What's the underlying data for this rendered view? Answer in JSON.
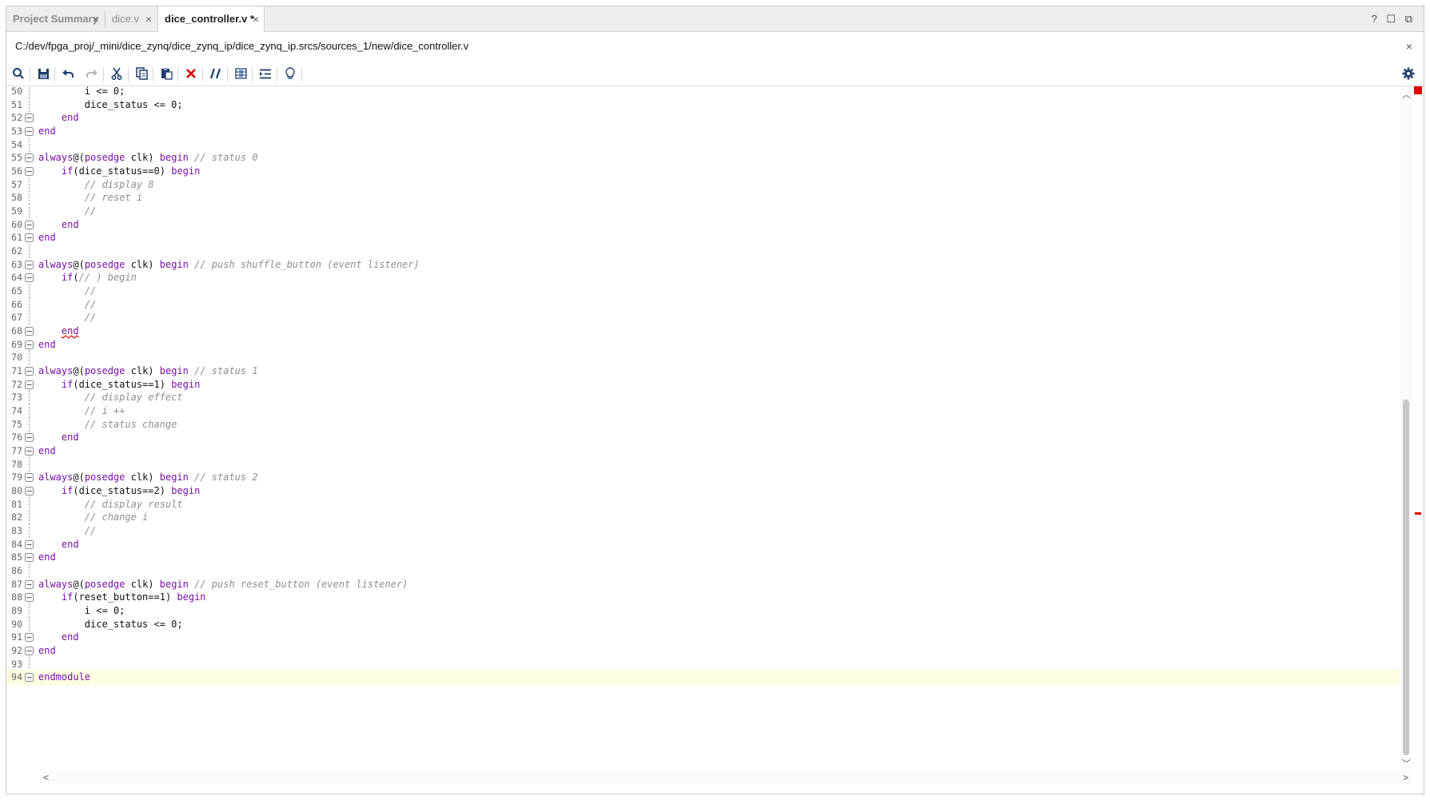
{
  "tabs": [
    {
      "label": "Project Summary",
      "active": false
    },
    {
      "label": "dice.v",
      "active": false
    },
    {
      "label": "dice_controller.v *",
      "active": true
    }
  ],
  "window_controls": {
    "help": "?",
    "restore": "☐",
    "detach": "⧉"
  },
  "path": "C:/dev/fpga_proj/_mini/dice_zynq/dice_zynq_ip/dice_zynq_ip.srcs/sources_1/new/dice_controller.v",
  "toolbar": {
    "buttons": [
      "search-icon",
      "save-icon",
      "undo-icon",
      "redo-icon",
      "cut-icon",
      "copy-icon",
      "paste-icon",
      "delete-icon",
      "comment-icon",
      "column-select-icon",
      "indent-icon",
      "lightbulb-icon"
    ],
    "settings": "gear-icon"
  },
  "colors": {
    "keyword": "#7a0fa6",
    "comment": "#8e8e8e",
    "error_marker": "#e00000",
    "current_line": "#fffde1"
  },
  "lines": [
    {
      "n": "50",
      "fold": false,
      "tokens": [
        [
          "",
          "        i <= 0;"
        ]
      ]
    },
    {
      "n": "51",
      "fold": false,
      "tokens": [
        [
          "",
          "        dice_status <= 0;"
        ]
      ]
    },
    {
      "n": "52",
      "fold": true,
      "tokens": [
        [
          "kw",
          "    end"
        ]
      ]
    },
    {
      "n": "53",
      "fold": true,
      "tokens": [
        [
          "kw",
          "end"
        ]
      ]
    },
    {
      "n": "54",
      "fold": false,
      "tokens": []
    },
    {
      "n": "55",
      "fold": true,
      "tokens": [
        [
          "kw",
          "always"
        ],
        [
          "",
          "@("
        ],
        [
          "kw",
          "posedge"
        ],
        [
          "",
          " clk) "
        ],
        [
          "kw",
          "begin"
        ],
        [
          "cm",
          " // status 0"
        ]
      ]
    },
    {
      "n": "56",
      "fold": true,
      "tokens": [
        [
          "",
          "    "
        ],
        [
          "kw",
          "if"
        ],
        [
          "",
          "(dice_status==0) "
        ],
        [
          "kw",
          "begin"
        ]
      ]
    },
    {
      "n": "57",
      "fold": false,
      "tokens": [
        [
          "cm",
          "        // display 8"
        ]
      ]
    },
    {
      "n": "58",
      "fold": false,
      "tokens": [
        [
          "cm",
          "        // reset i"
        ]
      ]
    },
    {
      "n": "59",
      "fold": false,
      "tokens": [
        [
          "cm",
          "        //"
        ]
      ]
    },
    {
      "n": "60",
      "fold": true,
      "tokens": [
        [
          "kw",
          "    end"
        ]
      ]
    },
    {
      "n": "61",
      "fold": true,
      "tokens": [
        [
          "kw",
          "end"
        ]
      ]
    },
    {
      "n": "62",
      "fold": false,
      "tokens": []
    },
    {
      "n": "63",
      "fold": true,
      "tokens": [
        [
          "kw",
          "always"
        ],
        [
          "",
          "@("
        ],
        [
          "kw",
          "posedge"
        ],
        [
          "",
          " clk) "
        ],
        [
          "kw",
          "begin"
        ],
        [
          "cm",
          " // push shuffle_button (event listener)"
        ]
      ]
    },
    {
      "n": "64",
      "fold": true,
      "tokens": [
        [
          "",
          "    "
        ],
        [
          "kw",
          "if"
        ],
        [
          "",
          "("
        ],
        [
          "cm",
          "// ) begin"
        ]
      ]
    },
    {
      "n": "65",
      "fold": false,
      "tokens": [
        [
          "cm",
          "        //"
        ]
      ]
    },
    {
      "n": "66",
      "fold": false,
      "tokens": [
        [
          "cm",
          "        //"
        ]
      ]
    },
    {
      "n": "67",
      "fold": false,
      "tokens": [
        [
          "cm",
          "        //"
        ]
      ]
    },
    {
      "n": "68",
      "fold": true,
      "tokens": [
        [
          "",
          "    "
        ],
        [
          "kw squiggle",
          "end"
        ]
      ]
    },
    {
      "n": "69",
      "fold": true,
      "tokens": [
        [
          "kw",
          "end"
        ]
      ]
    },
    {
      "n": "70",
      "fold": false,
      "tokens": []
    },
    {
      "n": "71",
      "fold": true,
      "tokens": [
        [
          "kw",
          "always"
        ],
        [
          "",
          "@("
        ],
        [
          "kw",
          "posedge"
        ],
        [
          "",
          " clk) "
        ],
        [
          "kw",
          "begin"
        ],
        [
          "cm",
          " // status 1"
        ]
      ]
    },
    {
      "n": "72",
      "fold": true,
      "tokens": [
        [
          "",
          "    "
        ],
        [
          "kw",
          "if"
        ],
        [
          "",
          "(dice_status==1) "
        ],
        [
          "kw",
          "begin"
        ]
      ]
    },
    {
      "n": "73",
      "fold": false,
      "tokens": [
        [
          "cm",
          "        // display effect"
        ]
      ]
    },
    {
      "n": "74",
      "fold": false,
      "tokens": [
        [
          "cm",
          "        // i ++"
        ]
      ]
    },
    {
      "n": "75",
      "fold": false,
      "tokens": [
        [
          "cm",
          "        // status change"
        ]
      ]
    },
    {
      "n": "76",
      "fold": true,
      "tokens": [
        [
          "kw",
          "    end"
        ]
      ]
    },
    {
      "n": "77",
      "fold": true,
      "tokens": [
        [
          "kw",
          "end"
        ]
      ]
    },
    {
      "n": "78",
      "fold": false,
      "tokens": []
    },
    {
      "n": "79",
      "fold": true,
      "tokens": [
        [
          "kw",
          "always"
        ],
        [
          "",
          "@("
        ],
        [
          "kw",
          "posedge"
        ],
        [
          "",
          " clk) "
        ],
        [
          "kw",
          "begin"
        ],
        [
          "cm",
          " // status 2"
        ]
      ]
    },
    {
      "n": "80",
      "fold": true,
      "tokens": [
        [
          "",
          "    "
        ],
        [
          "kw",
          "if"
        ],
        [
          "",
          "(dice_status==2) "
        ],
        [
          "kw",
          "begin"
        ]
      ]
    },
    {
      "n": "81",
      "fold": false,
      "tokens": [
        [
          "cm",
          "        // display result"
        ]
      ]
    },
    {
      "n": "82",
      "fold": false,
      "tokens": [
        [
          "cm",
          "        // change i"
        ]
      ]
    },
    {
      "n": "83",
      "fold": false,
      "tokens": [
        [
          "cm",
          "        //"
        ]
      ]
    },
    {
      "n": "84",
      "fold": true,
      "tokens": [
        [
          "kw",
          "    end"
        ]
      ]
    },
    {
      "n": "85",
      "fold": true,
      "tokens": [
        [
          "kw",
          "end"
        ]
      ]
    },
    {
      "n": "86",
      "fold": false,
      "tokens": []
    },
    {
      "n": "87",
      "fold": true,
      "tokens": [
        [
          "kw",
          "always"
        ],
        [
          "",
          "@("
        ],
        [
          "kw",
          "posedge"
        ],
        [
          "",
          " clk) "
        ],
        [
          "kw",
          "begin"
        ],
        [
          "cm",
          " // push reset_button (event listener)"
        ]
      ]
    },
    {
      "n": "88",
      "fold": true,
      "tokens": [
        [
          "",
          "    "
        ],
        [
          "kw",
          "if"
        ],
        [
          "",
          "(reset_button==1) "
        ],
        [
          "kw",
          "begin"
        ]
      ]
    },
    {
      "n": "89",
      "fold": false,
      "tokens": [
        [
          "",
          "        i <= 0;"
        ]
      ]
    },
    {
      "n": "90",
      "fold": false,
      "tokens": [
        [
          "",
          "        dice_status <= 0;"
        ]
      ]
    },
    {
      "n": "91",
      "fold": true,
      "tokens": [
        [
          "kw",
          "    end"
        ]
      ]
    },
    {
      "n": "92",
      "fold": true,
      "tokens": [
        [
          "kw",
          "end"
        ]
      ]
    },
    {
      "n": "93",
      "fold": false,
      "tokens": []
    },
    {
      "n": "94",
      "fold": true,
      "current": true,
      "tokens": [
        [
          "kw",
          "endmodule"
        ]
      ]
    }
  ]
}
